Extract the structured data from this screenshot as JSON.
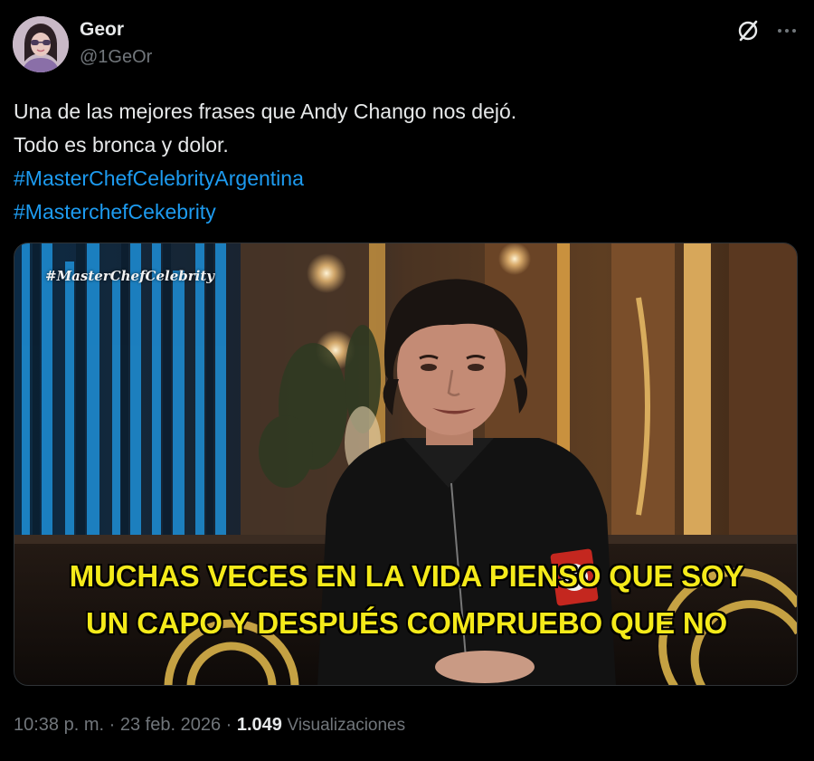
{
  "author": {
    "display_name": "Geor",
    "handle": "@1GeOr"
  },
  "header_actions": {
    "grok_icon": "grok-icon",
    "more_icon": "more-icon"
  },
  "tweet": {
    "line1": "Una de las mejores frases que Andy Chango nos dejó.",
    "line2": "Todo es bronca y dolor.",
    "hashtag1": "#MasterChefCelebrityArgentina",
    "hashtag2": "#MasterchefCekebrity"
  },
  "media": {
    "watermark": "#MasterChefCelebrity",
    "caption_line1": "MUCHAS VECES EN LA VIDA PIENSO QUE SOY",
    "caption_line2": "UN CAPO Y DESPUÉS COMPRUEBO QUE NO"
  },
  "meta": {
    "time": "10:38 p. m.",
    "separator": "·",
    "date": "23 feb. 2026",
    "views_count": "1.049",
    "views_label": "Visualizaciones"
  },
  "colors": {
    "background": "#000000",
    "text_primary": "#e7e9ea",
    "text_secondary": "#71767b",
    "link": "#1d9bf0",
    "caption": "#f4ea1a"
  }
}
